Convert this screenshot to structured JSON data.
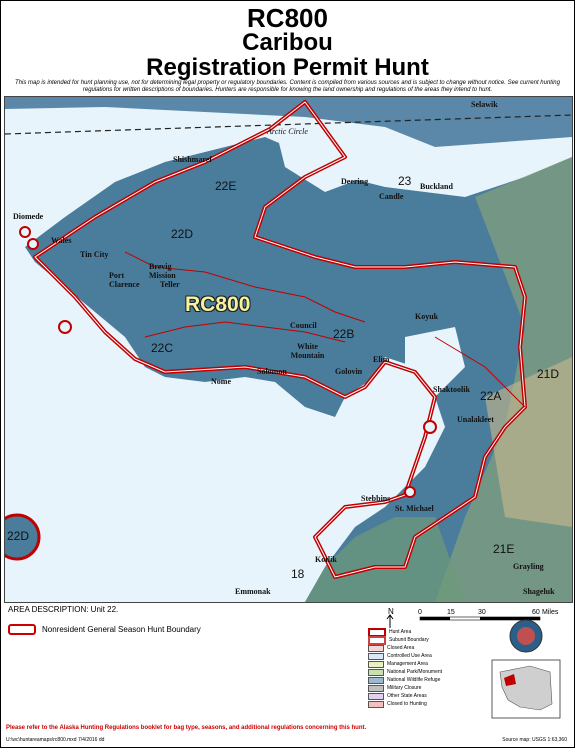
{
  "title": {
    "line1": "RC800",
    "line2": "Caribou",
    "line3": "Registration Permit Hunt"
  },
  "disclaimer": "This map is intended for hunt planning use, not for determining legal property or regulatory boundaries. Content is compiled from various sources and is subject to change without notice. See current hunting regulations for written descriptions of boundaries. Hunters are responsible for knowing the land ownership and regulations of the areas they intend to hunt.",
  "map": {
    "hunt_label": "RC800",
    "arctic_circle": "Arctic Circle",
    "places": [
      {
        "name": "Selawik"
      },
      {
        "name": "Shishmaref"
      },
      {
        "name": "Deering"
      },
      {
        "name": "Candle"
      },
      {
        "name": "Buckland"
      },
      {
        "name": "Diomede"
      },
      {
        "name": "Wales"
      },
      {
        "name": "Tin City"
      },
      {
        "name": "Brevig Mission"
      },
      {
        "name": "Port Clarence"
      },
      {
        "name": "Teller"
      },
      {
        "name": "Council"
      },
      {
        "name": "White Mountain"
      },
      {
        "name": "Koyuk"
      },
      {
        "name": "Elim"
      },
      {
        "name": "Golovin"
      },
      {
        "name": "Solomon"
      },
      {
        "name": "Nome"
      },
      {
        "name": "Shaktoolik"
      },
      {
        "name": "Unalakleet"
      },
      {
        "name": "Stebbins"
      },
      {
        "name": "St. Michael"
      },
      {
        "name": "Kotlik"
      },
      {
        "name": "Emmonak"
      },
      {
        "name": "Grayling"
      },
      {
        "name": "Shageluk"
      }
    ],
    "units": [
      "22E",
      "23",
      "22D",
      "22B",
      "22C",
      "22A",
      "21D",
      "21E",
      "18",
      "22D"
    ]
  },
  "area_description": "AREA DESCRIPTION:  Unit 22.",
  "boundary_label": "Nonresident General Season Hunt Boundary",
  "scale": {
    "ticks": [
      "0",
      "15",
      "30",
      "60"
    ],
    "unit": "Miles",
    "north": "N"
  },
  "legend": [
    "Hunt Area",
    "Subunit Boundary",
    "Closed Area",
    "Controlled Use Area",
    "Management Area",
    "National Park/Monument",
    "National Wildlife Refuge",
    "Military Closure",
    "Other State Areas",
    "Closed to Hunting"
  ],
  "legend_colors": [
    "#c00000",
    "#d04040",
    "#f0d8d8",
    "#d8e8f8",
    "#e8f0c0",
    "#c8e0b0",
    "#9bb8d0",
    "#c0c0c0",
    "#e0d0f0",
    "#f4c0c0"
  ],
  "footer": "Please refer to the Alaska Hunting Regulations booklet for bag type, seasons, and additional regulations concerning this hunt.",
  "source_left": "U:\\wc\\huntareamaps\\rc800.mxd  7/4/2016 dd",
  "source_right": "Source map: USGS 1:63,360"
}
